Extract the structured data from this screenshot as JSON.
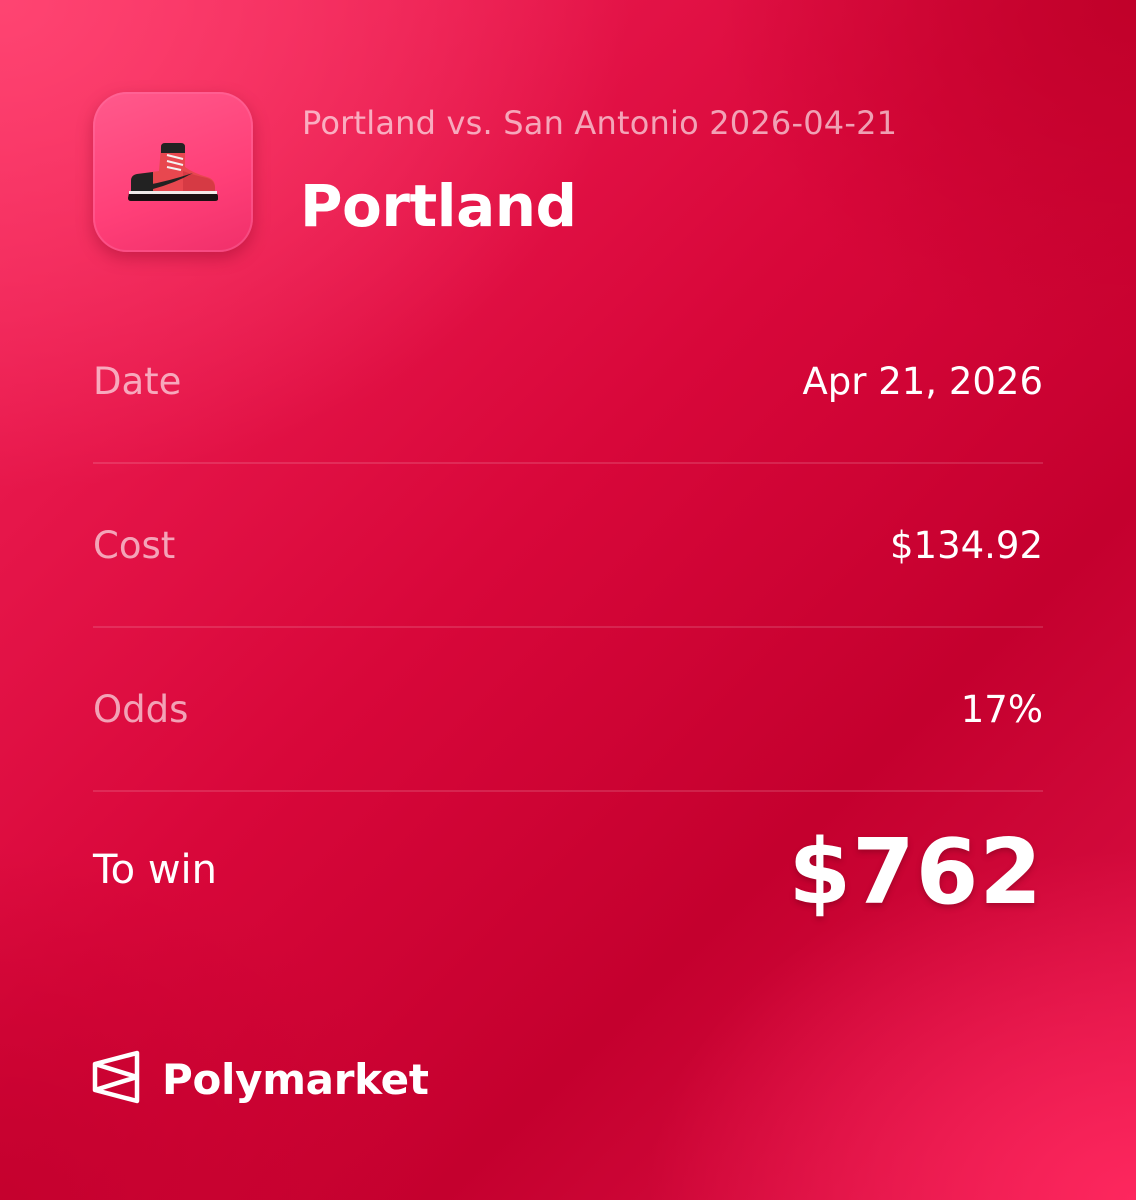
{
  "header": {
    "app_icon": "sneaker-icon",
    "market_title": "Portland vs. San Antonio 2026-04-21",
    "outcome": "Portland"
  },
  "details": [
    {
      "key": "date",
      "label": "Date",
      "value": "Apr 21, 2026"
    },
    {
      "key": "cost",
      "label": "Cost",
      "value": "$134.92"
    },
    {
      "key": "odds",
      "label": "Odds",
      "value": "17%"
    }
  ],
  "to_win": {
    "label": "To win",
    "value": "$762"
  },
  "brand": {
    "logo_icon": "polymarket-logo-icon",
    "name": "Polymarket"
  },
  "colors": {
    "background": "#d8073a",
    "icon_background": "#ff4a80",
    "text_primary": "#ffffff"
  }
}
